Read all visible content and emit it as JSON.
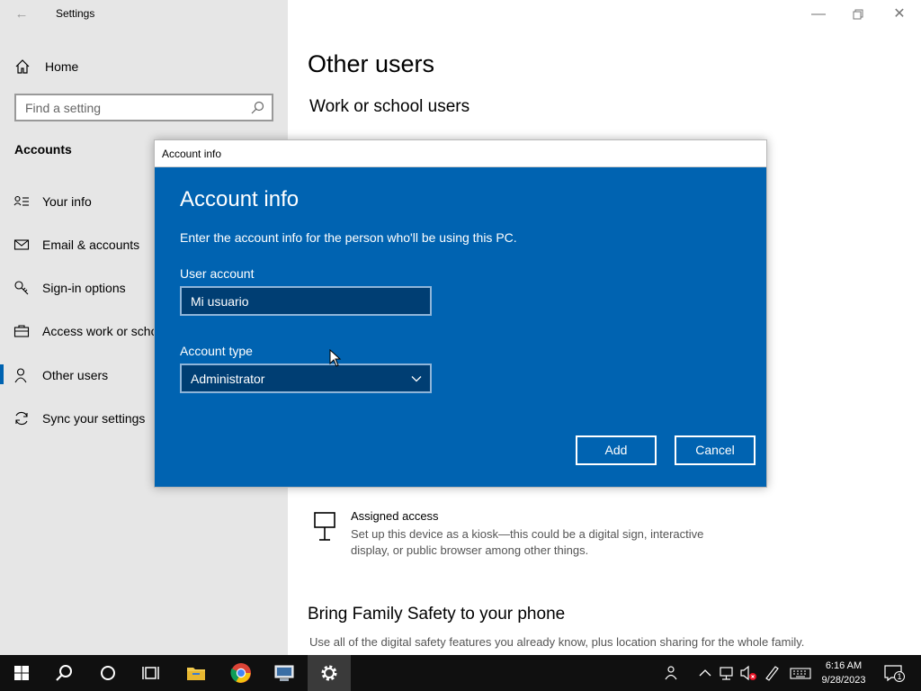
{
  "window": {
    "title": "Settings",
    "minimize_icon": "minimize-icon",
    "restore_icon": "restore-icon",
    "close_icon": "close-icon"
  },
  "sidebar": {
    "home_label": "Home",
    "search_placeholder": "Find a setting",
    "section_title": "Accounts",
    "items": [
      {
        "label": "Your info",
        "icon": "person-card-icon"
      },
      {
        "label": "Email & accounts",
        "icon": "mail-icon"
      },
      {
        "label": "Sign-in options",
        "icon": "key-icon"
      },
      {
        "label": "Access work or scho",
        "icon": "briefcase-icon"
      },
      {
        "label": "Other users",
        "icon": "person-icon",
        "active": true
      },
      {
        "label": "Sync your settings",
        "icon": "sync-icon"
      }
    ]
  },
  "main": {
    "title": "Other users",
    "subheading": "Work or school users",
    "assigned_access": {
      "title": "Assigned access",
      "description": "Set up this device as a kiosk—this could be a digital sign, interactive display, or public browser among other things."
    },
    "family": {
      "title": "Bring Family Safety to your phone",
      "description": "Use all of the digital safety features you already know, plus location sharing for the whole family."
    }
  },
  "dialog": {
    "window_title": "Account info",
    "heading": "Account info",
    "description": "Enter the account info for the person who'll be using this PC.",
    "user_account_label": "User account",
    "user_account_value": "Mi usuario",
    "account_type_label": "Account type",
    "account_type_value": "Administrator",
    "add_label": "Add",
    "cancel_label": "Cancel",
    "accent_color": "#0063b1"
  },
  "taskbar": {
    "apps": [
      "start-icon",
      "search-icon",
      "cortana-icon",
      "task-view-icon",
      "file-explorer-icon",
      "chrome-icon",
      "network-app-icon",
      "settings-icon"
    ],
    "time": "6:16 AM",
    "date": "9/28/2023",
    "notification_count": "1"
  }
}
